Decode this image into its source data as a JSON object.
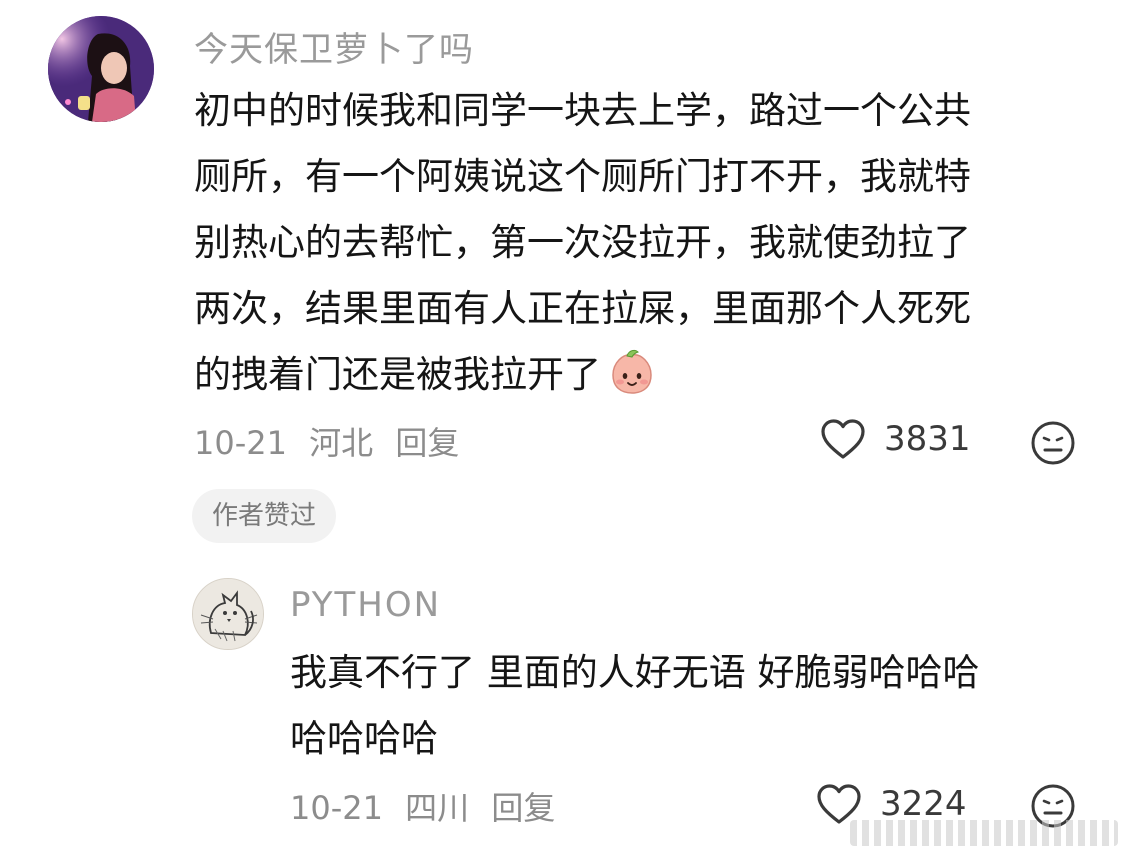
{
  "comment": {
    "username": "今天保卫萝卜了吗",
    "body_lines": [
      "初中的时候我和同学一块去上学，路过一个公共",
      "厕所，有一个阿姨说这个厕所门打不开，我就特",
      "别热心的去帮忙，第一次没拉开，我就使劲拉了",
      "两次，结果里面有人正在拉屎，里面那个人死死",
      "的拽着门还是被我拉开了"
    ],
    "date": "10-21",
    "location": "河北",
    "reply_label": "回复",
    "like_count": "3831",
    "author_liked_label": "作者赞过"
  },
  "reply": {
    "username": "PYTHON",
    "body_lines": [
      "我真不行了 里面的人好无语 好脆弱哈哈哈",
      "哈哈哈哈"
    ],
    "date": "10-21",
    "location": "四川",
    "reply_label": "回复",
    "like_count": "3224"
  },
  "icons": {
    "like": "heart-outline-icon",
    "dislike": "neutral-face-icon",
    "emoji": "peach-face-emoji"
  },
  "colors": {
    "username": "#9a9a9a",
    "body": "#151515",
    "meta": "#8c8c8c",
    "badge_bg": "#f2f2f2"
  }
}
